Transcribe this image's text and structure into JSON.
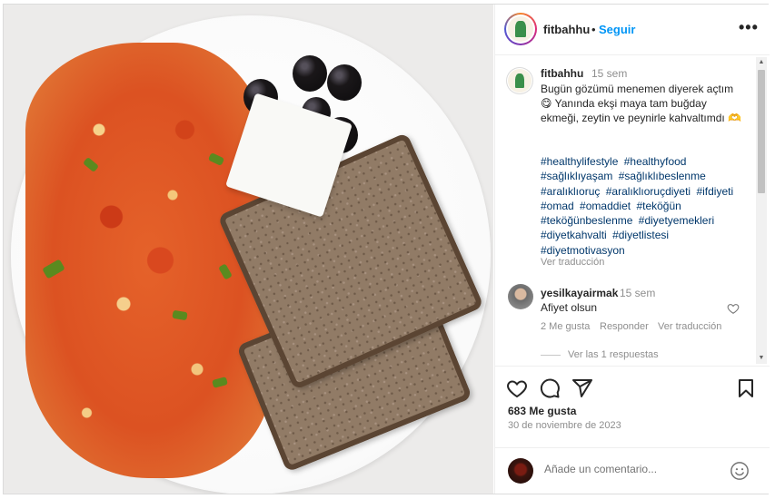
{
  "post": {
    "username": "fitbahhu",
    "dot": "•",
    "follow_label": "Seguir",
    "more_label": "•••"
  },
  "caption": {
    "username": "fitbahhu",
    "time": "15 sem",
    "text": "Bugün gözümü menemen diyerek açtım 😋 Yanında ekşi maya tam buğday ekmeği, zeytin ve peynirle kahvaltımdı 🫶",
    "hashtags": [
      "#healthylifestyle",
      "#healthyfood",
      "#sağlıklıyaşam",
      "#sağlıklıbeslenme",
      "#aralıklıoruç",
      "#aralıklıoruçdiyeti",
      "#ifdiyeti",
      "#omad",
      "#omaddiet",
      "#teköğün",
      "#teköğünbeslenme",
      "#diyetyemekleri",
      "#diyetkahvalti",
      "#diyetlistesi",
      "#diyetmotivasyon"
    ],
    "translate_label": "Ver traducción"
  },
  "comment": {
    "username": "yesilkayairmak",
    "time": "15 sem",
    "text": "Afiyet olsun",
    "likes": "2 Me gusta",
    "reply_label": "Responder",
    "translate_label": "Ver traducción",
    "view_replies": "Ver las 1 respuestas"
  },
  "stats": {
    "likes": "683 Me gusta",
    "date": "30 de noviembre de 2023"
  },
  "add_comment": {
    "placeholder": "Añade un comentario..."
  },
  "icons": {
    "like": "heart-icon",
    "comment": "comment-icon",
    "share": "share-icon",
    "save": "bookmark-icon",
    "more": "more-options-icon",
    "emoji": "emoji-icon"
  }
}
